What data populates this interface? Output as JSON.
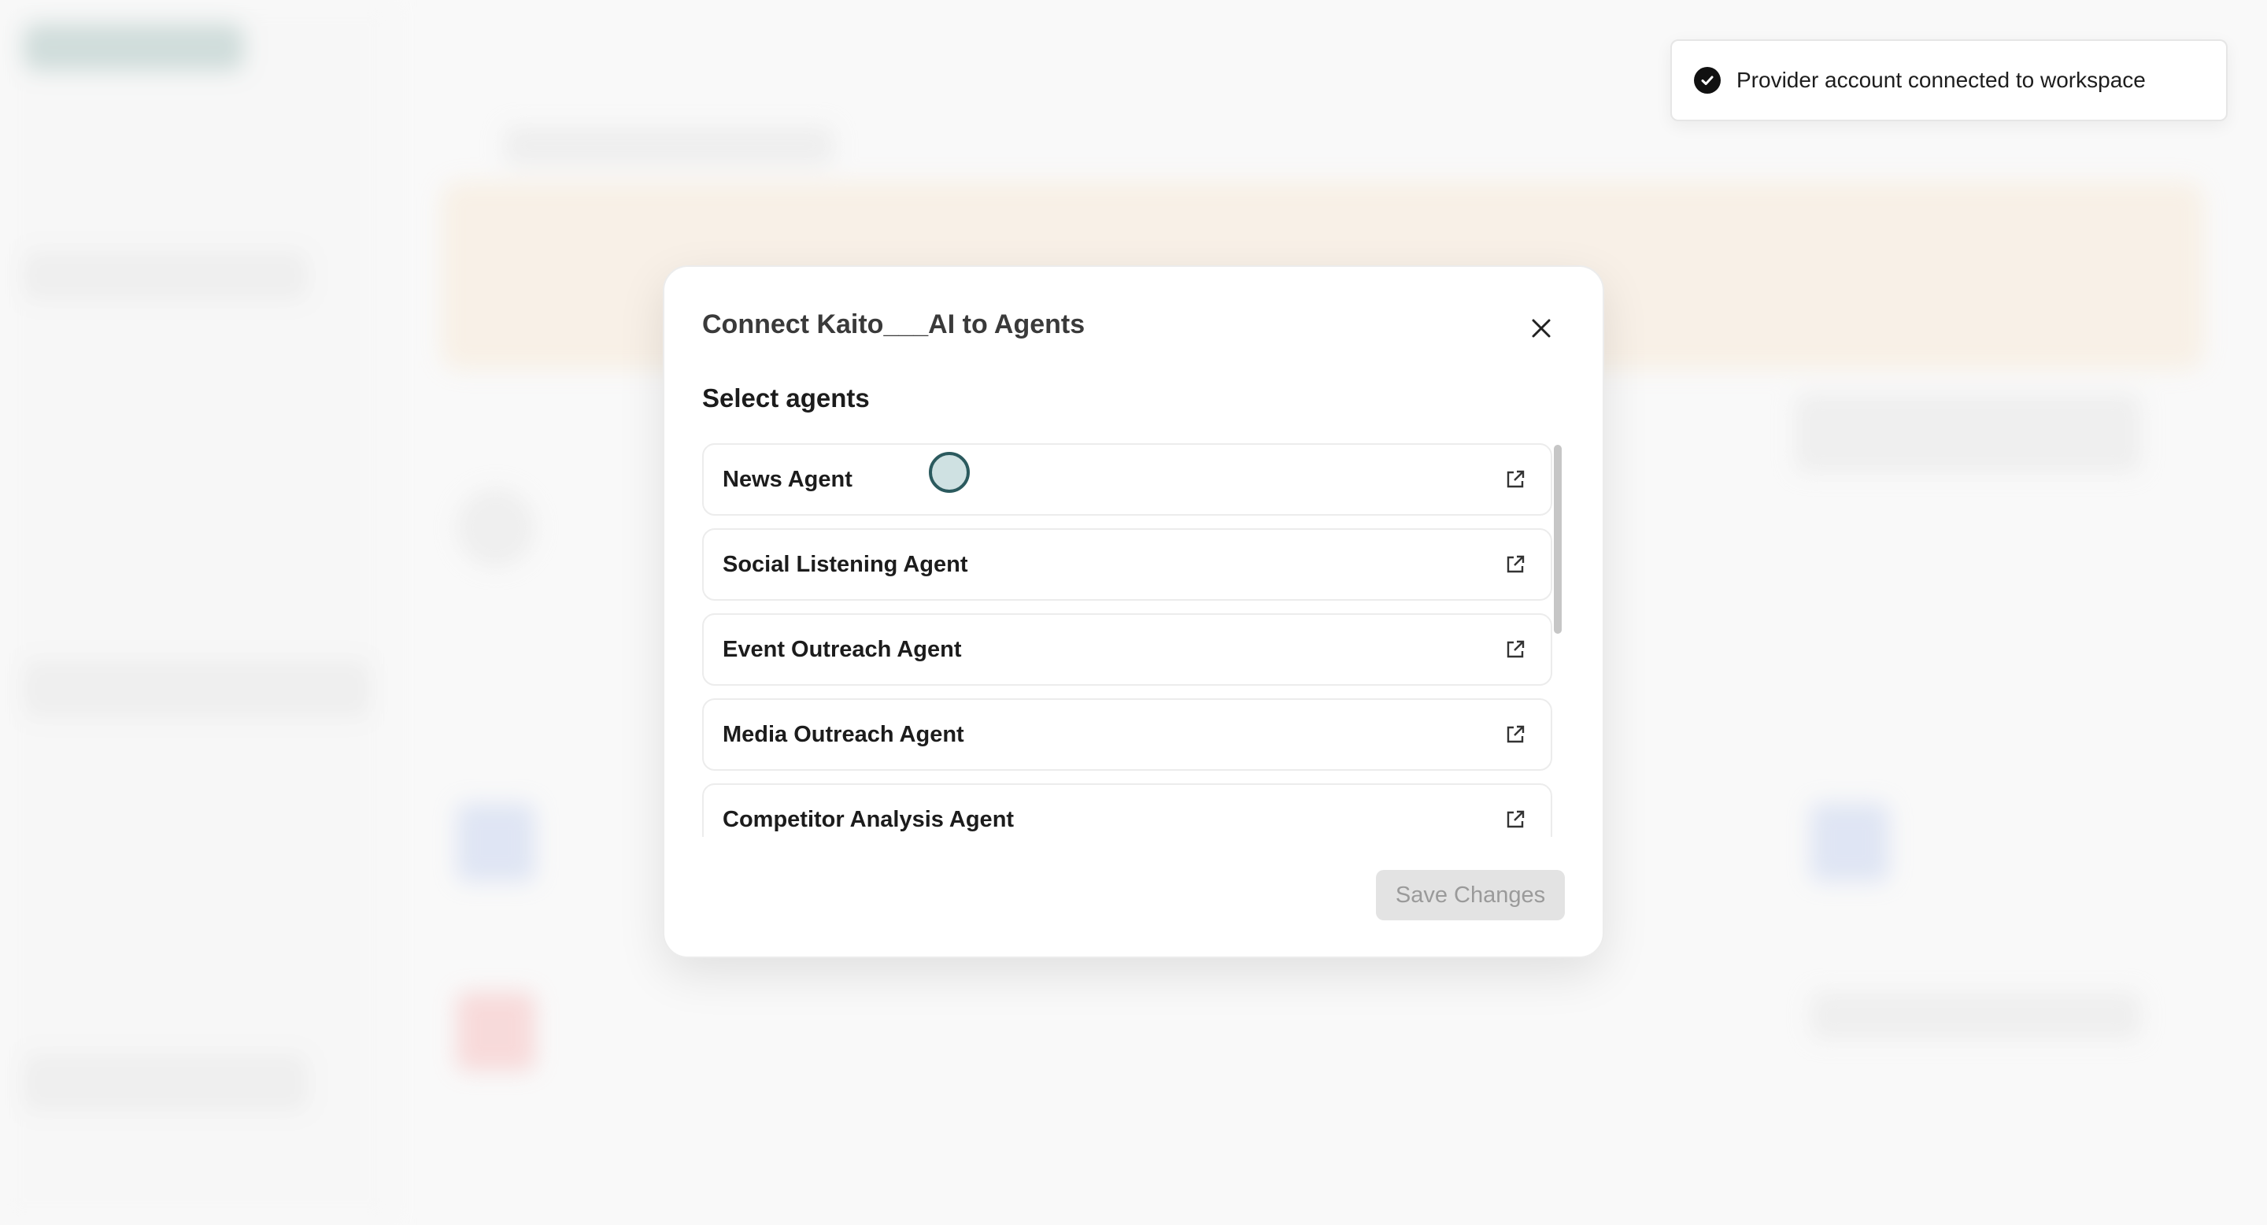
{
  "toast": {
    "message": "Provider account connected to workspace",
    "icon": "check-circle-icon"
  },
  "modal": {
    "title": "Connect Kaito___AI to Agents",
    "section_label": "Select agents",
    "agents": [
      {
        "name": "News Agent"
      },
      {
        "name": "Social Listening Agent"
      },
      {
        "name": "Event Outreach Agent"
      },
      {
        "name": "Media Outreach Agent"
      },
      {
        "name": "Competitor Analysis Agent"
      }
    ],
    "save_label": "Save Changes",
    "close_icon": "close-icon",
    "row_icon": "external-link-icon"
  },
  "colors": {
    "brand": "#2a6b63",
    "disabled_button_bg": "#e3e3e3",
    "disabled_button_text": "#9a9a9a"
  }
}
